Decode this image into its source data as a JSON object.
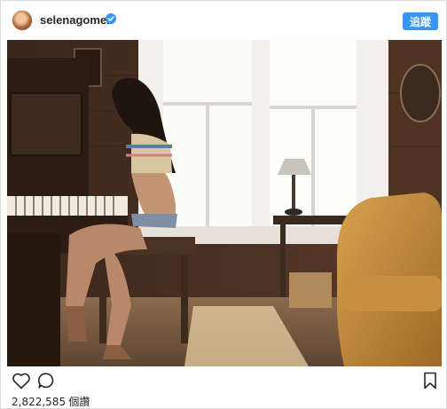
{
  "post": {
    "username": "selenagomez",
    "follow_label": "追蹤",
    "view_count": "2,822,585",
    "view_unit": "個讚"
  },
  "icons": {
    "verified": "verified-badge-icon",
    "like": "heart-icon",
    "comment": "comment-bubble-icon",
    "save": "bookmark-icon"
  },
  "colors": {
    "accent": "#3897f0",
    "text": "#262626",
    "border": "#dbdbdb"
  }
}
